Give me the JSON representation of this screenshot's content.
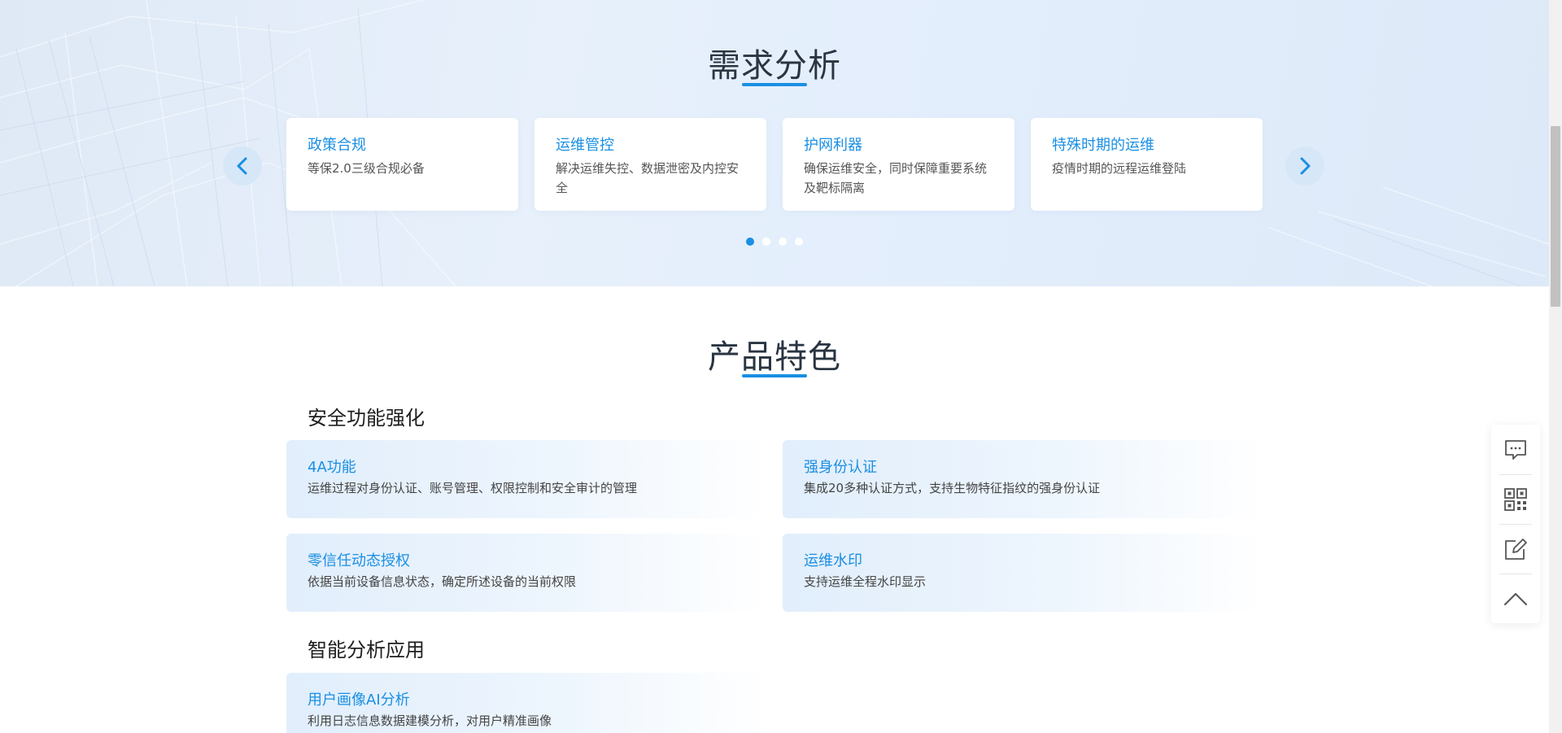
{
  "demand": {
    "title": "需求分析",
    "cards": [
      {
        "title": "政策合规",
        "desc": "等保2.0三级合规必备"
      },
      {
        "title": "运维管控",
        "desc": "解决运维失控、数据泄密及内控安全"
      },
      {
        "title": "护网利器",
        "desc": "确保运维安全，同时保障重要系统及靶标隔离"
      },
      {
        "title": "特殊时期的运维",
        "desc": "疫情时期的远程运维登陆"
      }
    ],
    "prev_icon": "chevron-left-icon",
    "next_icon": "chevron-right-icon",
    "pagination": {
      "total": 4,
      "active": 1
    }
  },
  "features": {
    "title": "产品特色",
    "groups": [
      {
        "title": "安全功能强化",
        "items": [
          {
            "title": "4A功能",
            "desc": "运维过程对身份认证、账号管理、权限控制和安全审计的管理"
          },
          {
            "title": "强身份认证",
            "desc": "集成20多种认证方式，支持生物特征指纹的强身份认证"
          },
          {
            "title": "零信任动态授权",
            "desc": "依据当前设备信息状态，确定所述设备的当前权限"
          },
          {
            "title": "运维水印",
            "desc": "支持运维全程水印显示"
          }
        ]
      },
      {
        "title": "智能分析应用",
        "items": [
          {
            "title": "用户画像AI分析",
            "desc": "利用日志信息数据建模分析，对用户精准画像"
          }
        ]
      }
    ]
  },
  "float_bar": {
    "items": [
      "chat-icon",
      "qrcode-icon",
      "edit-icon",
      "back-to-top-icon"
    ]
  },
  "colors": {
    "accent": "#1a8fe3",
    "title": "#2a3442"
  }
}
